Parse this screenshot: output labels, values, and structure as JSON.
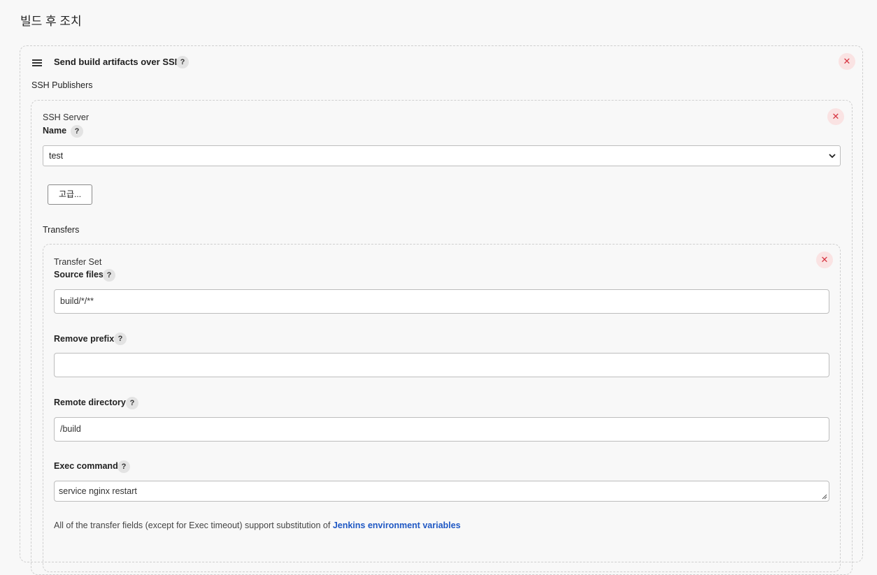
{
  "section": {
    "title": "빌드 후 조치"
  },
  "step": {
    "title": "Send build artifacts over SSH",
    "help": "?",
    "remove": "✕"
  },
  "ssh_publishers": {
    "label": "SSH Publishers",
    "server": {
      "heading": "SSH Server",
      "name_label": "Name",
      "name_value": "test",
      "advanced_button": "고급...",
      "remove": "✕"
    },
    "transfers": {
      "label": "Transfers",
      "set": {
        "heading": "Transfer Set",
        "remove": "✕",
        "source_files": {
          "label": "Source files",
          "value": "build/*/**"
        },
        "remove_prefix": {
          "label": "Remove prefix",
          "value": ""
        },
        "remote_directory": {
          "label": "Remote directory",
          "value": "/build"
        },
        "exec_command": {
          "label": "Exec command",
          "value": "service nginx restart"
        },
        "note_text": "All of the transfer fields (except for Exec timeout) support substitution of ",
        "note_link": "Jenkins environment variables"
      }
    }
  },
  "colors": {
    "background": "#f8f8f8",
    "remove_red": "#d6323f",
    "link_blue": "#1f58c4"
  },
  "icons": {
    "drag": "drag-handle-icon",
    "help": "help-icon",
    "remove": "close-icon",
    "dropdown": "chevron-down-icon"
  }
}
